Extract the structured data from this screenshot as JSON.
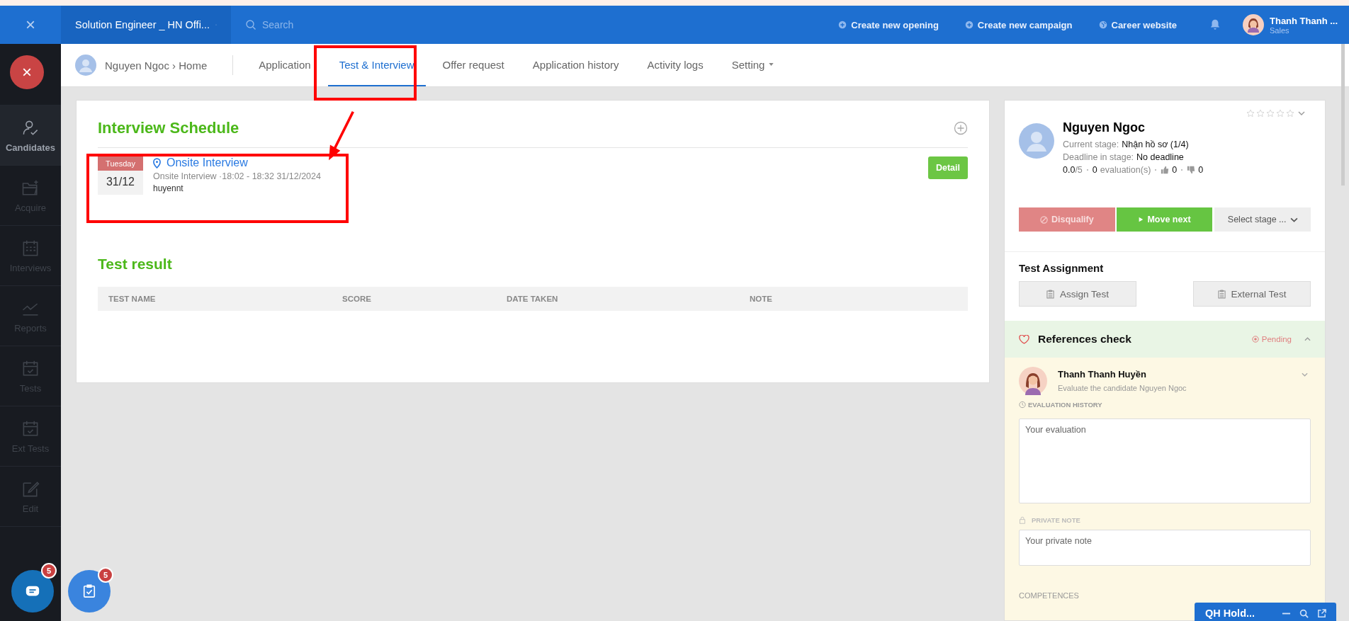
{
  "topbar": {
    "close": "×",
    "job": "Solution Engineer _ HN Offi...",
    "search": {
      "placeholder": "Search"
    },
    "actions": [
      {
        "kind": "plus",
        "label": "Create new opening"
      },
      {
        "kind": "plus",
        "label": "Create new campaign"
      },
      {
        "kind": "globe",
        "label": "Career website"
      }
    ],
    "user": {
      "name": "Thanh Thanh ...",
      "role": "Sales"
    }
  },
  "sidebar": {
    "items": [
      {
        "kind": "candidates",
        "label": "Candidates",
        "selected": true
      },
      {
        "kind": "acquire",
        "label": "Acquire",
        "selected": false
      },
      {
        "kind": "interviews",
        "label": "Interviews",
        "selected": false
      },
      {
        "kind": "reports",
        "label": "Reports",
        "selected": false
      },
      {
        "kind": "tests",
        "label": "Tests",
        "selected": false
      },
      {
        "kind": "tests",
        "label": "Ext Tests",
        "selected": false
      },
      {
        "kind": "edit",
        "label": "Edit",
        "selected": false
      }
    ],
    "close": "×",
    "chat_badge": "5"
  },
  "subnav": {
    "breadcrumb": "Nguyen Ngoc › Home",
    "tabs": [
      {
        "label": "Application",
        "selected": false
      },
      {
        "label": "Test & Interview",
        "selected": true
      },
      {
        "label": "Offer request",
        "selected": false
      },
      {
        "label": "Application history",
        "selected": false
      },
      {
        "label": "Activity logs",
        "selected": false
      },
      {
        "label": "Setting",
        "selected": false,
        "dropdown": true
      }
    ]
  },
  "schedule": {
    "title": "Interview Schedule",
    "items": [
      {
        "weekday": "Tuesday",
        "date": "31/12",
        "title": "Onsite Interview",
        "detail": "Onsite Interview ·18:02 - 18:32 31/12/2024",
        "owner": "huyennt",
        "button": "Detail"
      }
    ]
  },
  "test_result": {
    "title": "Test result",
    "columns": [
      "TEST NAME",
      "SCORE",
      "DATE TAKEN",
      "NOTE"
    ]
  },
  "candidate": {
    "stars": 0,
    "name": "Nguyen Ngoc",
    "stage_label": "Current stage:",
    "stage": "Nhận hồ sơ (1/4)",
    "deadline_label": "Deadline in stage:",
    "deadline": "No deadline",
    "score": "0.0",
    "score_max": "/5",
    "evaluations": "0",
    "evaluations_label": "evaluation(s)",
    "likes": "0",
    "dislikes": "0",
    "disqualify": "Disqualify",
    "move_next": "Move next",
    "select_stage": "Select stage ..."
  },
  "test_assignment": {
    "title": "Test Assignment",
    "buttons": [
      "Assign Test",
      "External Test"
    ]
  },
  "references": {
    "title": "References check",
    "status": "Pending",
    "expanded": true,
    "reviewer": {
      "name": "Thanh Thanh Huyền",
      "subtitle": "Evaluate the candidate Nguyen Ngoc"
    },
    "history_label": "EVALUATION HISTORY",
    "evaluation": {
      "placeholder": "Your evaluation"
    },
    "private_label": "PRIVATE NOTE",
    "private_note": {
      "placeholder": "Your private note"
    },
    "competences": "COMPETENCES"
  },
  "tasks_badge": "5",
  "chat_window": {
    "title": "QH Hold..."
  }
}
